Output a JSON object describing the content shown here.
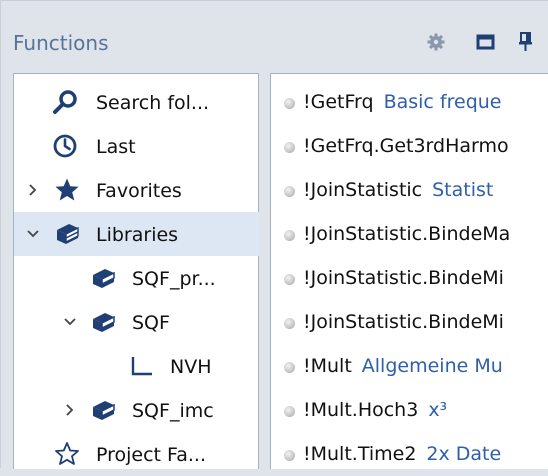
{
  "header": {
    "title": "Functions",
    "icons": [
      "gear-icon",
      "restore-window-icon",
      "pin-icon"
    ]
  },
  "tree": {
    "items": [
      {
        "label": "Search fol...",
        "icon": "search-icon",
        "expander": "none",
        "selected": false
      },
      {
        "label": "Last",
        "icon": "clock-icon",
        "expander": "none",
        "selected": false
      },
      {
        "label": "Favorites",
        "icon": "star-filled-icon",
        "expander": "collapsed",
        "selected": false
      },
      {
        "label": "Libraries",
        "icon": "books-icon",
        "expander": "expanded",
        "selected": true
      },
      {
        "label": "SQF_pr...",
        "icon": "book-icon",
        "expander": "none",
        "selected": false
      },
      {
        "label": "SQF",
        "icon": "book-icon",
        "expander": "expanded",
        "selected": false
      },
      {
        "label": "NVH",
        "icon": "tree-branch-icon",
        "expander": "none",
        "selected": false
      },
      {
        "label": "SQF_imc",
        "icon": "book-icon",
        "expander": "collapsed",
        "selected": false
      },
      {
        "label": "Project Fa...",
        "icon": "star-outline-icon",
        "expander": "none",
        "selected": false
      }
    ]
  },
  "functions": {
    "items": [
      {
        "name": "!GetFrq",
        "desc": "Basic freque"
      },
      {
        "name": "!GetFrq.Get3rdHarmo",
        "desc": ""
      },
      {
        "name": "!JoinStatistic",
        "desc": "Statist"
      },
      {
        "name": "!JoinStatistic.BindeMa",
        "desc": ""
      },
      {
        "name": "!JoinStatistic.BindeMi",
        "desc": ""
      },
      {
        "name": "!JoinStatistic.BindeMi",
        "desc": ""
      },
      {
        "name": "!Mult",
        "desc": "Allgemeine Mu"
      },
      {
        "name": "!Mult.Hoch3",
        "desc": "x³"
      },
      {
        "name": "!Mult.Time2",
        "desc": "2x Date"
      }
    ]
  },
  "colors": {
    "panel_bg": "#dfe3ea",
    "header_text": "#5a7398",
    "icon_blue": "#1f3f75",
    "desc_text": "#2e5fa8",
    "selection": "#dde6f3"
  }
}
